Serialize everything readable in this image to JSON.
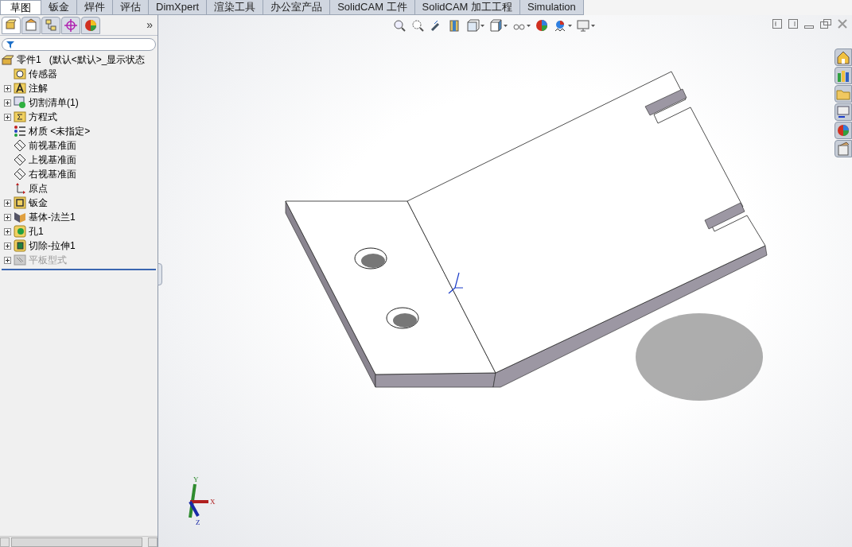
{
  "tabs": [
    {
      "label": "草图",
      "selected": true
    },
    {
      "label": "钣金",
      "selected": false
    },
    {
      "label": "焊件",
      "selected": false
    },
    {
      "label": "评估",
      "selected": false
    },
    {
      "label": "DimXpert",
      "selected": false
    },
    {
      "label": "渲染工具",
      "selected": false
    },
    {
      "label": "办公室产品",
      "selected": false
    },
    {
      "label": "SolidCAM 工件",
      "selected": false
    },
    {
      "label": "SolidCAM 加工工程",
      "selected": false
    },
    {
      "label": "Simulation",
      "selected": false
    }
  ],
  "panel_tabs": [
    {
      "kind": "feature",
      "selected": true
    },
    {
      "kind": "property",
      "selected": false
    },
    {
      "kind": "config",
      "selected": false
    },
    {
      "kind": "dim",
      "selected": false
    },
    {
      "kind": "display",
      "selected": false
    }
  ],
  "panel_more": "»",
  "tree": {
    "root": "零件1   (默认<默认>_显示状态",
    "items": [
      {
        "kind": "sensor",
        "label": "传感器",
        "expandable": false,
        "disabled": false
      },
      {
        "kind": "annotation",
        "label": "注解",
        "expandable": true,
        "disabled": false
      },
      {
        "kind": "cutlist",
        "label": "切割清单(1)",
        "expandable": true,
        "disabled": false
      },
      {
        "kind": "equation",
        "label": "方程式",
        "expandable": true,
        "disabled": false
      },
      {
        "kind": "material",
        "label": "材质 <未指定>",
        "expandable": false,
        "disabled": false
      },
      {
        "kind": "plane",
        "label": "前视基准面",
        "expandable": false,
        "disabled": false
      },
      {
        "kind": "plane",
        "label": "上视基准面",
        "expandable": false,
        "disabled": false
      },
      {
        "kind": "plane",
        "label": "右视基准面",
        "expandable": false,
        "disabled": false
      },
      {
        "kind": "origin",
        "label": "原点",
        "expandable": false,
        "disabled": false
      },
      {
        "kind": "sheetmetal",
        "label": "钣金",
        "expandable": true,
        "disabled": false
      },
      {
        "kind": "flange",
        "label": "基体-法兰1",
        "expandable": true,
        "disabled": false
      },
      {
        "kind": "hole",
        "label": "孔1",
        "expandable": true,
        "disabled": false
      },
      {
        "kind": "cut",
        "label": "切除-拉伸1",
        "expandable": true,
        "disabled": false
      },
      {
        "kind": "flat",
        "label": "平板型式",
        "expandable": true,
        "disabled": true
      }
    ]
  },
  "triad": {
    "x": "X",
    "y": "Y",
    "z": "Z"
  }
}
